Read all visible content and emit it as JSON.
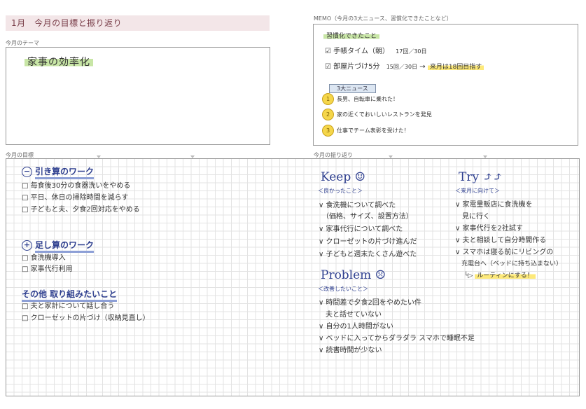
{
  "header": {
    "month_title": "1月　今月の目標と振り返り"
  },
  "labels": {
    "theme": "今月のテーマ",
    "memo": "MEMO（今月の3大ニュース、習慣化できたことなど）",
    "goals": "今月の目標",
    "reflection": "今月の振り返り"
  },
  "theme": {
    "text": "家事の効率化"
  },
  "memo": {
    "habits_title": "習慣化できたこと",
    "habits": [
      {
        "text": "手帳タイム（朝）",
        "count": "17回／30日"
      },
      {
        "text": "部屋片づけ5分",
        "count": "15回／30日",
        "arrow": "→",
        "note": "来月は18回目指す"
      }
    ],
    "news_title": "3大ニュース",
    "news": [
      {
        "rank": "1",
        "text": "長男、自転車に乗れた！"
      },
      {
        "rank": "2",
        "text": "家の近くでおいしいレストランを発見"
      },
      {
        "rank": "3",
        "text": "仕事でチーム表彰を受けた！"
      }
    ]
  },
  "goals": {
    "minus": {
      "symbol": "−",
      "title": "引き算のワーク",
      "items": [
        "□ 毎食後30分の食器洗いをやめる",
        "□ 平日、休日の掃除時間を減らす",
        "□ 子どもと夫、夕食2回対応をやめる"
      ]
    },
    "plus": {
      "symbol": "+",
      "title": "足し算のワーク",
      "items": [
        "□ 食洗機導入",
        "□ 家事代行利用"
      ]
    },
    "other": {
      "title": "その他 取り組みたいこと",
      "items": [
        "□ 夫と家計について話し合う",
        "□ クローゼットの片づけ（収納見直し）"
      ]
    }
  },
  "reflection": {
    "keep": {
      "title": "Keep ☺",
      "sub": "＜良かったこと＞",
      "items": [
        "∨ 食洗機について調べた",
        "　（価格、サイズ、設置方法）",
        "∨ 家事代行について調べた",
        "∨ クローゼットの片づけ進んだ",
        "∨ 子どもと週末たくさん遊べた"
      ]
    },
    "problem": {
      "title": "Problem ☹",
      "sub": "＜改善したいこと＞",
      "items": [
        "∨ 時間差で夕食2回をやめたい件",
        "　夫と話せていない",
        "∨ 自分の1人時間がない",
        "∨ ベッドに入ってからダラダラ スマホで睡眠不足",
        "∨ 読書時間が少ない"
      ]
    },
    "try": {
      "title": "Try ⤴⤴",
      "sub": "＜来月に向けて＞",
      "items": [
        "∨ 家電量販店に食洗機を",
        "　見に行く",
        "∨ 家事代行を2社試す",
        "∨ 夫と相談して自分時間作る",
        "∨ スマホは寝る前にリビングの",
        "　充電台へ（ベッドに持ち込まない）"
      ],
      "arrow": "└▷",
      "routine": "ルーティンにする！"
    }
  }
}
